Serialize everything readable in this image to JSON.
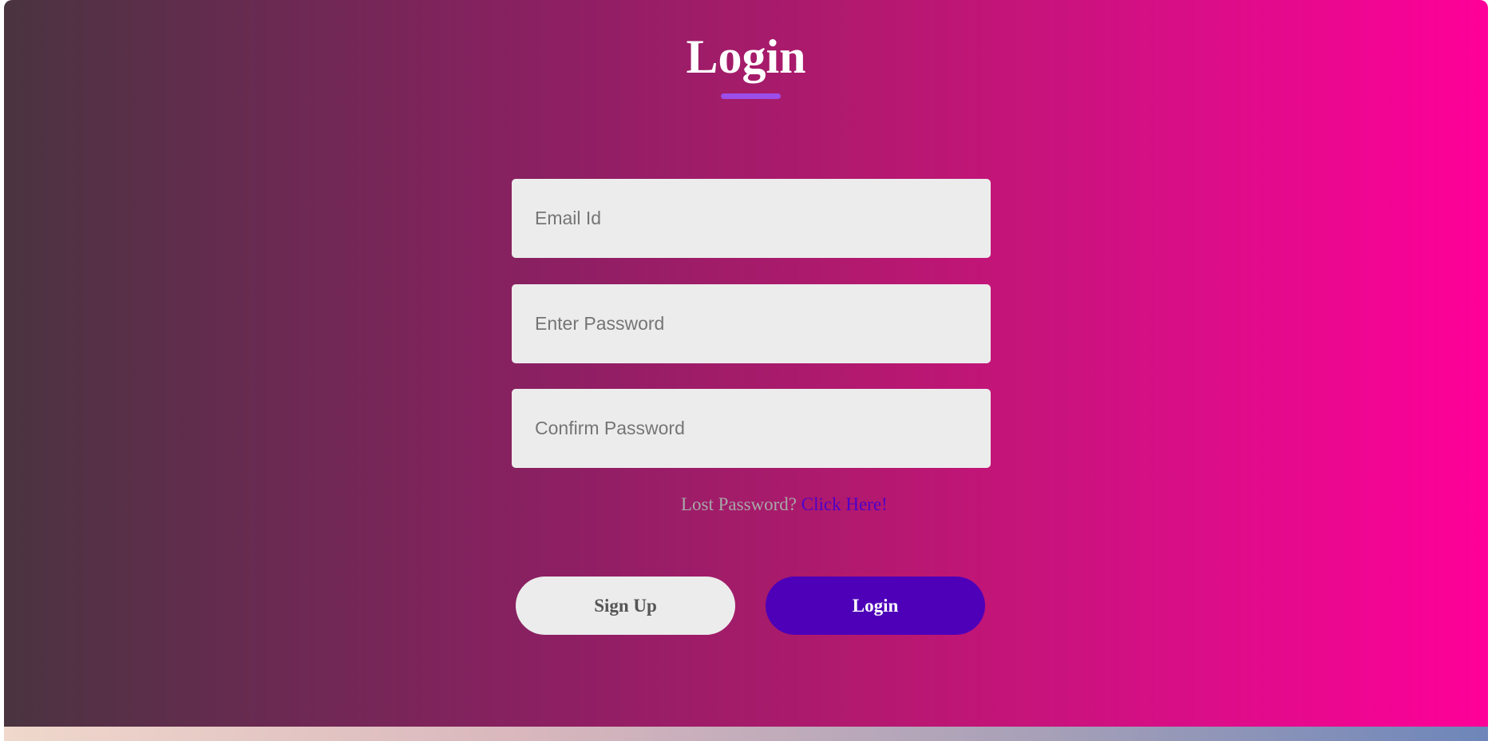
{
  "form": {
    "title": "Login",
    "fields": {
      "email": {
        "placeholder": "Email Id",
        "value": ""
      },
      "password": {
        "placeholder": "Enter Password",
        "value": ""
      },
      "confirm_password": {
        "placeholder": "Confirm Password",
        "value": ""
      }
    },
    "lost_password": {
      "text": "Lost Password?",
      "link": "Click Here!"
    },
    "buttons": {
      "signup": "Sign Up",
      "login": "Login"
    }
  },
  "colors": {
    "gradient_start": "#4a3440",
    "gradient_end": "#ff0099",
    "accent": "#4e00b9",
    "underline": "#9b4ee8",
    "link": "#4e00c9"
  }
}
